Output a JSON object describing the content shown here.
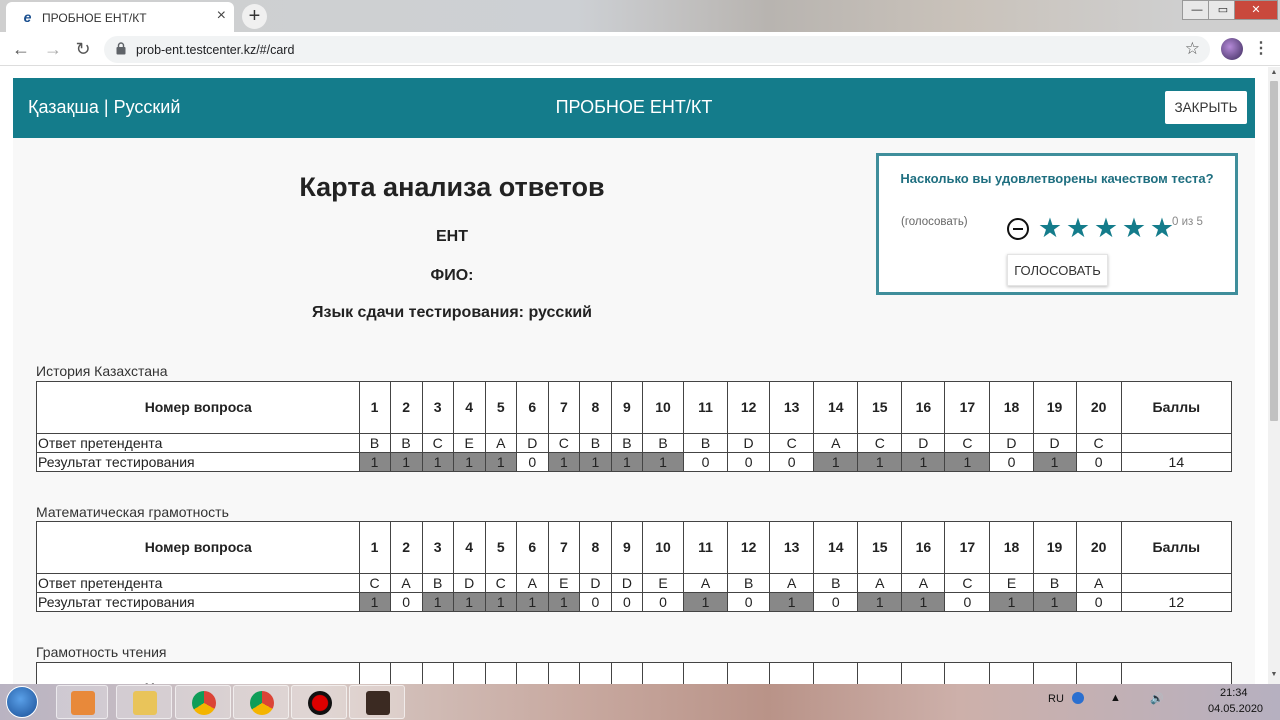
{
  "browser": {
    "tab_title": "ПРОБНОЕ ЕНТ/КТ",
    "tab_close": "×",
    "new_tab": "+",
    "url": "prob-ent.testcenter.kz/#/card",
    "win_min": "—",
    "win_max": "▭",
    "win_close": "✕"
  },
  "header": {
    "lang_kz": "Қазақша",
    "lang_sep": "|",
    "lang_ru": "Русский",
    "brand": "ПРОБНОЕ ЕНТ/КТ",
    "close_button": "ЗАКРЫТЬ",
    "accent_color": "#147c8b"
  },
  "card": {
    "title": "Карта анализа ответов",
    "exam": "ЕНТ",
    "fio": "ФИО:",
    "language": "Язык сдачи тестирования: русский"
  },
  "survey": {
    "question": "Насколько вы удовлетворены качеством теста?",
    "hint": "(голосовать)",
    "count": "0 из 5",
    "rating": 0,
    "max_rating": 5,
    "vote_button": "ГОЛОСОВАТЬ"
  },
  "table_labels": {
    "question_no": "Номер вопроса",
    "answer": "Ответ претендента",
    "result": "Результат тестирования",
    "score": "Баллы"
  },
  "sections": [
    {
      "name": "История Казахстана",
      "answers": [
        "B",
        "B",
        "C",
        "E",
        "A",
        "D",
        "C",
        "B",
        "B",
        "B",
        "B",
        "D",
        "C",
        "A",
        "C",
        "D",
        "C",
        "D",
        "D",
        "C"
      ],
      "results": [
        "1",
        "1",
        "1",
        "1",
        "1",
        "0",
        "1",
        "1",
        "1",
        "1",
        "0",
        "0",
        "0",
        "1",
        "1",
        "1",
        "1",
        "0",
        "1",
        "0"
      ],
      "score": "14"
    },
    {
      "name": "Математическая грамотность",
      "answers": [
        "C",
        "A",
        "B",
        "D",
        "C",
        "A",
        "E",
        "D",
        "D",
        "E",
        "A",
        "B",
        "A",
        "B",
        "A",
        "A",
        "C",
        "E",
        "B",
        "A"
      ],
      "results": [
        "1",
        "0",
        "1",
        "1",
        "1",
        "1",
        "1",
        "0",
        "0",
        "0",
        "1",
        "0",
        "1",
        "0",
        "1",
        "1",
        "0",
        "1",
        "1",
        "0"
      ],
      "score": "12"
    },
    {
      "name": "Грамотность чтения",
      "answers": [],
      "results": [],
      "score": ""
    }
  ],
  "taskbar": {
    "lang": "RU",
    "time": "21:34",
    "date": "04.05.2020"
  }
}
